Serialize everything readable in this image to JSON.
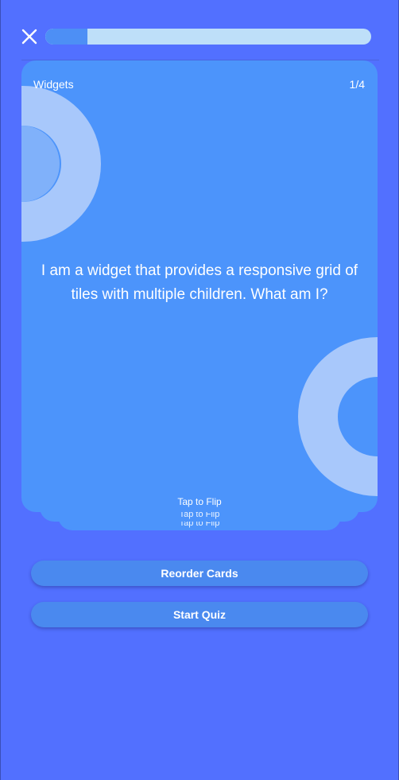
{
  "header": {
    "close_icon": "close-icon",
    "progress": {
      "current": 1,
      "total": 4,
      "fraction": 0.13
    }
  },
  "card": {
    "category": "Widgets",
    "counter": "1/4",
    "question": "I am a widget that provides a responsive grid of tiles with multiple children. What am I?",
    "hint": "Tap to Flip"
  },
  "stack": {
    "hint_1": "Tap to Flip",
    "hint_2": "Tap to Flip"
  },
  "actions": {
    "reorder_label": "Reorder Cards",
    "quiz_label": "Start Quiz"
  },
  "colors": {
    "background": "#5270ff",
    "card": "#4c94fb",
    "progress_track": "#bedff9",
    "progress_fill": "#4d8ff5",
    "button": "#4a89ef"
  }
}
